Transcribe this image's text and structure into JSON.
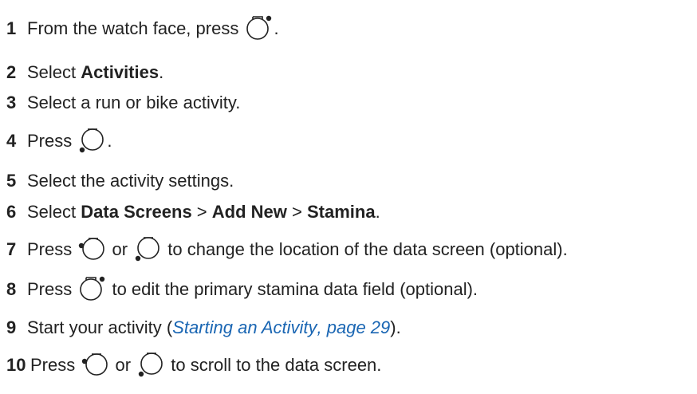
{
  "steps": [
    {
      "num": "1",
      "a": "From the watch face, press ",
      "b": "."
    },
    {
      "num": "2",
      "a": "Select ",
      "bold": "Activities",
      "b": "."
    },
    {
      "num": "3",
      "a": "Select a run or bike activity."
    },
    {
      "num": "4",
      "a": "Press ",
      "b": "."
    },
    {
      "num": "5",
      "a": "Select the activity settings."
    },
    {
      "num": "6",
      "a": "Select ",
      "bold1": "Data Screens",
      "sep1": " > ",
      "bold2": "Add New",
      "sep2": " > ",
      "bold3": "Stamina",
      "b": "."
    },
    {
      "num": "7",
      "a": "Press ",
      "or": " or ",
      "b": " to change the location of the data screen (optional)."
    },
    {
      "num": "8",
      "a": "Press ",
      "b": " to edit the primary stamina data field (optional)."
    },
    {
      "num": "9",
      "a": "Start your activity (",
      "link": "Starting an Activity",
      "c": ", page 29",
      "b": ")."
    },
    {
      "num": "10",
      "a": "Press ",
      "or": " or ",
      "b": " to scroll to the data screen."
    }
  ],
  "icons": {
    "start": "watch-start-button-icon",
    "down": "watch-down-button-icon",
    "up": "watch-up-button-icon"
  }
}
